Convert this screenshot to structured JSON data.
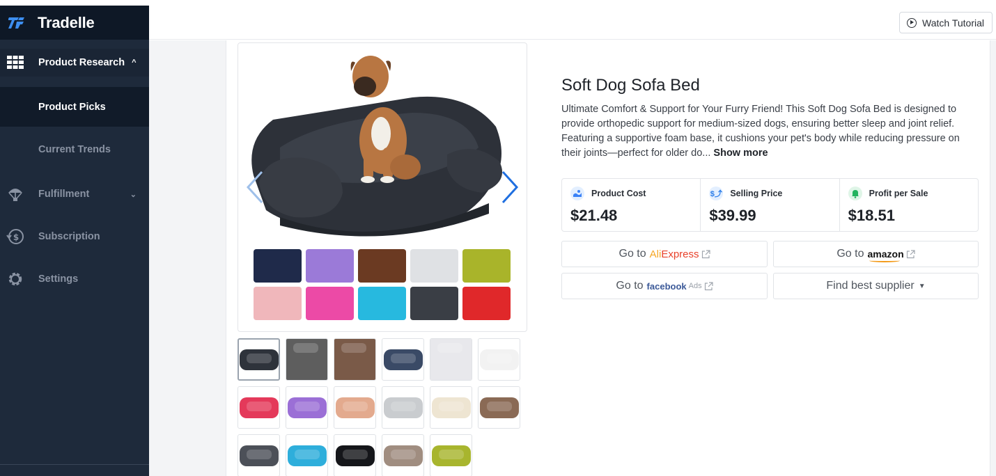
{
  "brand": {
    "name": "Tradelle",
    "logo_icon": "tradelle-logo-icon"
  },
  "sidebar": {
    "items": [
      {
        "label": "Product Research",
        "icon": "grid-icon",
        "expanded": true
      },
      {
        "label": "Product Picks",
        "active": true
      },
      {
        "label": "Current Trends"
      },
      {
        "label": "Fulfillment",
        "icon": "parachute-icon"
      },
      {
        "label": "Subscription",
        "icon": "dollar-cycle-icon"
      },
      {
        "label": "Settings",
        "icon": "gear-icon"
      }
    ]
  },
  "topbar": {
    "watch_tutorial_label": "Watch Tutorial"
  },
  "product": {
    "title": "Soft Dog Sofa Bed",
    "description": "Ultimate Comfort & Support for Your Furry Friend! This Soft Dog Sofa Bed is designed to provide orthopedic support for medium-sized dogs, ensuring better sleep and joint relief. Featuring a supportive foam base, it cushions your pet's body while reducing pressure on their joints—perfect for older do...",
    "show_more_label": "Show more",
    "swatch_colors": [
      "#1f2a4a",
      "#9b7ad8",
      "#6b3a22",
      "#dfe1e4",
      "#a9b42a",
      "#f0b7bb",
      "#ec4aa6",
      "#27b9df",
      "#3a3e45",
      "#e0282a"
    ],
    "thumbnail_colors": [
      "#2e333b",
      "#5e5e5e",
      "#7a5a48",
      "#3a4a66",
      "#e8e8ec",
      "#f2f2f2",
      "#e4395a",
      "#9b6fd6",
      "#e3aa8e",
      "#c9cccf",
      "#eee5d2",
      "#8a6a55",
      "#4c5058",
      "#2eaedb",
      "#15161a",
      "#a08d80",
      "#a8b52e"
    ]
  },
  "stats": [
    {
      "label": "Product Cost",
      "value": "$21.48",
      "icon": "product-cost-icon",
      "color": "#3b82f6"
    },
    {
      "label": "Selling Price",
      "value": "$39.99",
      "icon": "selling-price-icon",
      "color": "#2b7de9"
    },
    {
      "label": "Profit per Sale",
      "value": "$18.51",
      "icon": "profit-bell-icon",
      "color": "#22b35e"
    }
  ],
  "actions": {
    "go_to": "Go to",
    "aliexpress_ali": "Ali",
    "aliexpress_express": "Express",
    "amazon": "amazon",
    "facebook": "facebook",
    "facebook_ads": "Ads",
    "find_supplier": "Find best supplier"
  }
}
